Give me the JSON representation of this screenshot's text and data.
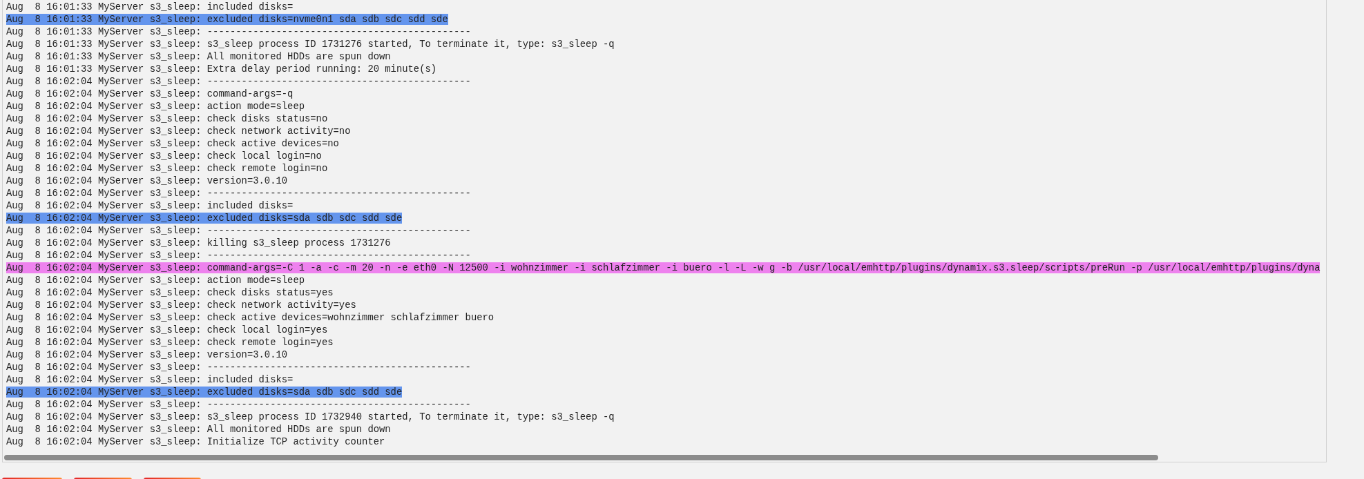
{
  "log": {
    "lines": [
      {
        "text": "Aug  8 16:01:33 MyServer s3_sleep: included disks="
      },
      {
        "text": "Aug  8 16:01:33 MyServer s3_sleep: excluded disks=nvme0n1 sda sdb sdc sdd sde",
        "color": "#6495ed"
      },
      {
        "text": "Aug  8 16:01:33 MyServer s3_sleep: ----------------------------------------------"
      },
      {
        "text": "Aug  8 16:01:33 MyServer s3_sleep: s3_sleep process ID 1731276 started, To terminate it, type: s3_sleep -q"
      },
      {
        "text": "Aug  8 16:01:33 MyServer s3_sleep: All monitored HDDs are spun down"
      },
      {
        "text": "Aug  8 16:01:33 MyServer s3_sleep: Extra delay period running: 20 minute(s)"
      },
      {
        "text": "Aug  8 16:02:04 MyServer s3_sleep: ----------------------------------------------"
      },
      {
        "text": "Aug  8 16:02:04 MyServer s3_sleep: command-args=-q"
      },
      {
        "text": "Aug  8 16:02:04 MyServer s3_sleep: action mode=sleep"
      },
      {
        "text": "Aug  8 16:02:04 MyServer s3_sleep: check disks status=no"
      },
      {
        "text": "Aug  8 16:02:04 MyServer s3_sleep: check network activity=no"
      },
      {
        "text": "Aug  8 16:02:04 MyServer s3_sleep: check active devices=no"
      },
      {
        "text": "Aug  8 16:02:04 MyServer s3_sleep: check local login=no"
      },
      {
        "text": "Aug  8 16:02:04 MyServer s3_sleep: check remote login=no"
      },
      {
        "text": "Aug  8 16:02:04 MyServer s3_sleep: version=3.0.10"
      },
      {
        "text": "Aug  8 16:02:04 MyServer s3_sleep: ----------------------------------------------"
      },
      {
        "text": "Aug  8 16:02:04 MyServer s3_sleep: included disks="
      },
      {
        "text": "Aug  8 16:02:04 MyServer s3_sleep: excluded disks=sda sdb sdc sdd sde",
        "color": "#6495ed"
      },
      {
        "text": "Aug  8 16:02:04 MyServer s3_sleep: ----------------------------------------------"
      },
      {
        "text": "Aug  8 16:02:04 MyServer s3_sleep: killing s3_sleep process 1731276"
      },
      {
        "text": "Aug  8 16:02:04 MyServer s3_sleep: ----------------------------------------------"
      },
      {
        "text": "Aug  8 16:02:04 MyServer s3_sleep: command-args=-C 1 -a -c -m 20 -n -e eth0 -N 12500 -i wohnzimmer -i schlafzimmer -i buero -l -L -w g -b /usr/local/emhttp/plugins/dynamix.s3.sleep/scripts/preRun -p /usr/local/emhttp/plugins/dyna",
        "color": "#ee82ee"
      },
      {
        "text": "Aug  8 16:02:04 MyServer s3_sleep: action mode=sleep"
      },
      {
        "text": "Aug  8 16:02:04 MyServer s3_sleep: check disks status=yes"
      },
      {
        "text": "Aug  8 16:02:04 MyServer s3_sleep: check network activity=yes"
      },
      {
        "text": "Aug  8 16:02:04 MyServer s3_sleep: check active devices=wohnzimmer schlafzimmer buero"
      },
      {
        "text": "Aug  8 16:02:04 MyServer s3_sleep: check local login=yes"
      },
      {
        "text": "Aug  8 16:02:04 MyServer s3_sleep: check remote login=yes"
      },
      {
        "text": "Aug  8 16:02:04 MyServer s3_sleep: version=3.0.10"
      },
      {
        "text": "Aug  8 16:02:04 MyServer s3_sleep: ----------------------------------------------"
      },
      {
        "text": "Aug  8 16:02:04 MyServer s3_sleep: included disks="
      },
      {
        "text": "Aug  8 16:02:04 MyServer s3_sleep: excluded disks=sda sdb sdc sdd sde",
        "color": "#6495ed"
      },
      {
        "text": "Aug  8 16:02:04 MyServer s3_sleep: ----------------------------------------------"
      },
      {
        "text": "Aug  8 16:02:04 MyServer s3_sleep: s3_sleep process ID 1732940 started, To terminate it, type: s3_sleep -q"
      },
      {
        "text": "Aug  8 16:02:04 MyServer s3_sleep: All monitored HDDs are spun down"
      },
      {
        "text": "Aug  8 16:02:04 MyServer s3_sleep: Initialize TCP activity counter"
      }
    ]
  }
}
